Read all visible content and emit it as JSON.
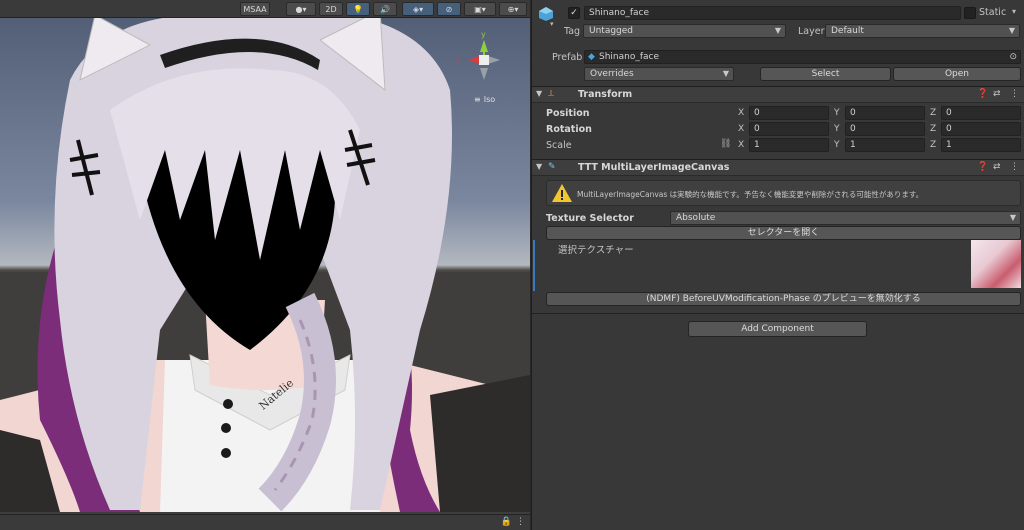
{
  "scene": {
    "toolbar": {
      "msaa_label": "MSAA",
      "mode_2d_label": "2D"
    },
    "gizmo": {
      "x_label": "x",
      "y_label": "y",
      "projection_label": "Iso"
    },
    "status": {
      "lock_icon": "lock-icon",
      "menu_icon": "kebab-menu-icon"
    },
    "shirt_text": "Natelie"
  },
  "inspector": {
    "header": {
      "object_name": "Shinano_face",
      "static_label": "Static",
      "active_checked": true,
      "tag_label": "Tag",
      "tag_value": "Untagged",
      "layer_label": "Layer",
      "layer_value": "Default",
      "prefab_label": "Prefab",
      "prefab_value": "Shinano_face",
      "overrides_label": "Overrides",
      "select_label": "Select",
      "open_label": "Open"
    },
    "transform": {
      "title": "Transform",
      "position_label": "Position",
      "rotation_label": "Rotation",
      "scale_label": "Scale",
      "position": {
        "x": "0",
        "y": "0",
        "z": "0"
      },
      "rotation": {
        "x": "0",
        "y": "0",
        "z": "0"
      },
      "scale": {
        "x": "1",
        "y": "1",
        "z": "1"
      },
      "axis_x": "X",
      "axis_y": "Y",
      "axis_z": "Z"
    },
    "ttt": {
      "title": "TTT MultiLayerImageCanvas",
      "warning_text": "MultiLayerImageCanvas は実験的な機能です。予告なく機能変更や削除がされる可能性があります。",
      "texture_selector_label": "Texture Selector",
      "texture_selector_value": "Absolute",
      "open_selector_label": "セレクターを開く",
      "selected_texture_label": "選択テクスチャー",
      "disable_preview_label": "(NDMF) BeforeUVModification-Phase のプレビューを無効化する"
    },
    "add_component_label": "Add Component"
  },
  "colors": {
    "inspector_bg": "#383838",
    "field_bg": "#2a2a2a",
    "button_bg": "#565656",
    "warning_yellow": "#f2c531",
    "gizmo_x": "#db3b3b",
    "gizmo_y": "#8fce3e",
    "gizmo_z": "#3b7ddb"
  }
}
